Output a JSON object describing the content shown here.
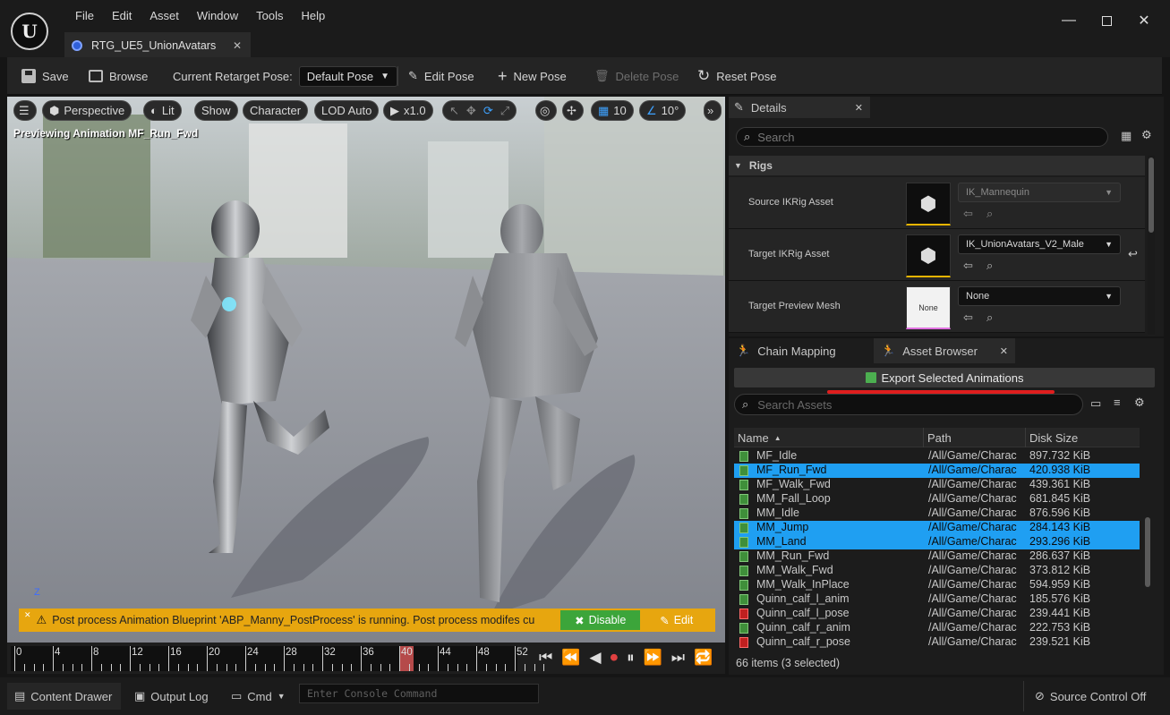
{
  "menu": [
    "File",
    "Edit",
    "Asset",
    "Window",
    "Tools",
    "Help"
  ],
  "document_tab": "RTG_UE5_UnionAvatars",
  "toolbar": {
    "save": "Save",
    "browse": "Browse",
    "retarget_pose_label": "Current Retarget Pose:",
    "retarget_pose_value": "Default Pose",
    "edit_pose": "Edit Pose",
    "new_pose": "New Pose",
    "delete_pose": "Delete Pose",
    "reset_pose": "Reset Pose"
  },
  "viewport": {
    "perspective": "Perspective",
    "lit": "Lit",
    "show": "Show",
    "character": "Character",
    "lod": "LOD Auto",
    "speed": "x1.0",
    "grid_snap": "10",
    "angle_snap": "10°",
    "preview_text": "Previewing Animation MF_Run_Fwd",
    "axis_label": "Z",
    "warning": "Post process Animation Blueprint 'ABP_Manny_PostProcess' is running. Post process modifes cu",
    "disable": "Disable",
    "edit": "Edit"
  },
  "timeline": {
    "ticks": [
      "0",
      "4",
      "8",
      "12",
      "16",
      "20",
      "24",
      "28",
      "32",
      "36",
      "40",
      "44",
      "48",
      "52"
    ],
    "current_frame": "40"
  },
  "details": {
    "tab": "Details",
    "search_placeholder": "Search",
    "section": "Rigs",
    "rows": [
      {
        "label": "Source IKRig Asset",
        "value": "IK_Mannequin"
      },
      {
        "label": "Target IKRig Asset",
        "value": "IK_UnionAvatars_V2_Male"
      },
      {
        "label": "Target Preview Mesh",
        "value": "None",
        "thumb": "None"
      }
    ]
  },
  "asset_panel": {
    "tab_chain": "Chain Mapping",
    "tab_assets": "Asset Browser",
    "export_button": "Export Selected Animations",
    "search_placeholder": "Search Assets",
    "columns": [
      "Name",
      "Path",
      "Disk Size"
    ],
    "rows": [
      {
        "name": "MF_Idle",
        "path": "/All/Game/Charac",
        "size": "897.732 KiB",
        "selected": false,
        "icon": "green"
      },
      {
        "name": "MF_Run_Fwd",
        "path": "/All/Game/Charac",
        "size": "420.938 KiB",
        "selected": true,
        "icon": "green"
      },
      {
        "name": "MF_Walk_Fwd",
        "path": "/All/Game/Charac",
        "size": "439.361 KiB",
        "selected": false,
        "icon": "green"
      },
      {
        "name": "MM_Fall_Loop",
        "path": "/All/Game/Charac",
        "size": "681.845 KiB",
        "selected": false,
        "icon": "green"
      },
      {
        "name": "MM_Idle",
        "path": "/All/Game/Charac",
        "size": "876.596 KiB",
        "selected": false,
        "icon": "green"
      },
      {
        "name": "MM_Jump",
        "path": "/All/Game/Charac",
        "size": "284.143 KiB",
        "selected": true,
        "icon": "green"
      },
      {
        "name": "MM_Land",
        "path": "/All/Game/Charac",
        "size": "293.296 KiB",
        "selected": true,
        "icon": "green"
      },
      {
        "name": "MM_Run_Fwd",
        "path": "/All/Game/Charac",
        "size": "286.637 KiB",
        "selected": false,
        "icon": "green"
      },
      {
        "name": "MM_Walk_Fwd",
        "path": "/All/Game/Charac",
        "size": "373.812 KiB",
        "selected": false,
        "icon": "green"
      },
      {
        "name": "MM_Walk_InPlace",
        "path": "/All/Game/Charac",
        "size": "594.959 KiB",
        "selected": false,
        "icon": "green"
      },
      {
        "name": "Quinn_calf_l_anim",
        "path": "/All/Game/Charac",
        "size": "185.576 KiB",
        "selected": false,
        "icon": "green"
      },
      {
        "name": "Quinn_calf_l_pose",
        "path": "/All/Game/Charac",
        "size": "239.441 KiB",
        "selected": false,
        "icon": "red"
      },
      {
        "name": "Quinn_calf_r_anim",
        "path": "/All/Game/Charac",
        "size": "222.753 KiB",
        "selected": false,
        "icon": "green"
      },
      {
        "name": "Quinn_calf_r_pose",
        "path": "/All/Game/Charac",
        "size": "239.521 KiB",
        "selected": false,
        "icon": "red"
      }
    ],
    "item_count": "66 items (3 selected)"
  },
  "statusbar": {
    "content_drawer": "Content Drawer",
    "output_log": "Output Log",
    "cmd": "Cmd",
    "console_placeholder": "Enter Console Command",
    "source_control": "Source Control Off"
  },
  "colors": {
    "selection": "#1f9ff2",
    "warning_bg": "#e7a60f",
    "disable_btn": "#3ca53a",
    "underline_red": "#e01e1e"
  }
}
